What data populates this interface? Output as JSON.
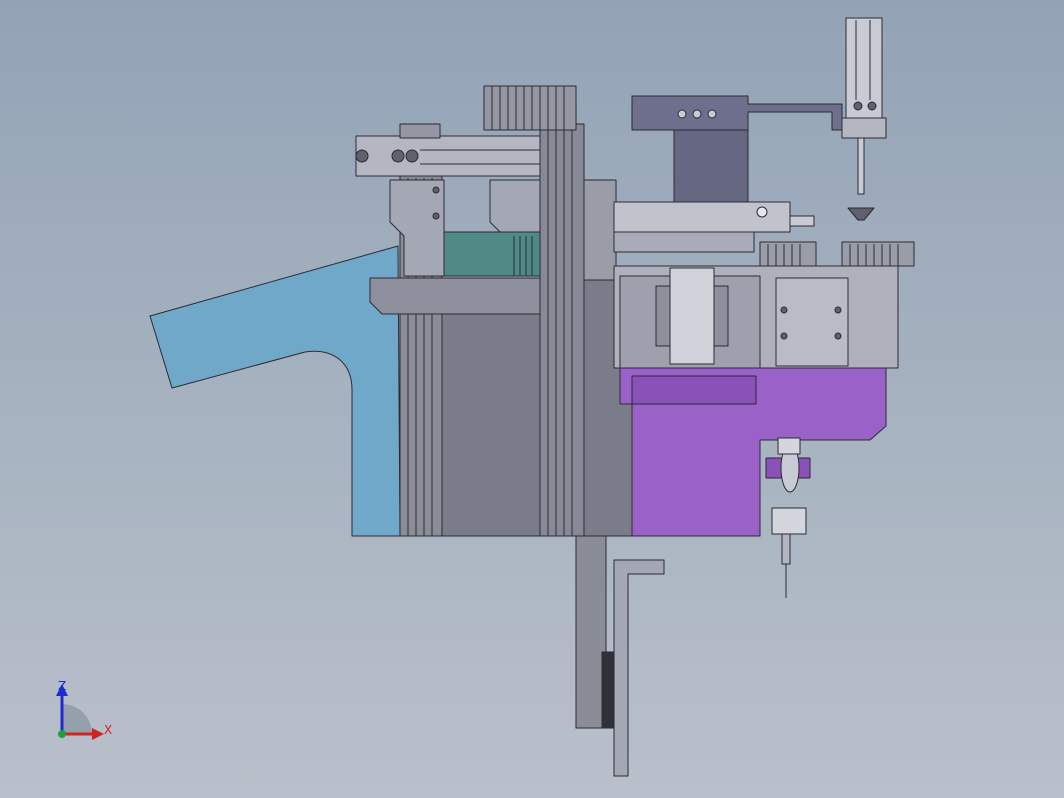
{
  "viewport": {
    "background_top": "#93a3b6",
    "background_bottom": "#b9c0cb"
  },
  "model": {
    "colors": {
      "blue_part": "#6fa8c8",
      "gray_body": "#7b7c8a",
      "gray_light": "#a4a7b4",
      "gray_dark": "#5f6070",
      "slate_plate": "#6e6f8c",
      "purple_part": "#9a62c9",
      "teal_part": "#4f8a86",
      "silver": "#c8cbd3",
      "outline": "#2b2b33"
    }
  },
  "triad": {
    "z_label": "Z",
    "x_label": "X",
    "z_color": "#1d2bd6",
    "x_color": "#d42222",
    "y_color": "#1aa33a",
    "icon": "coordinate-triad-icon"
  }
}
